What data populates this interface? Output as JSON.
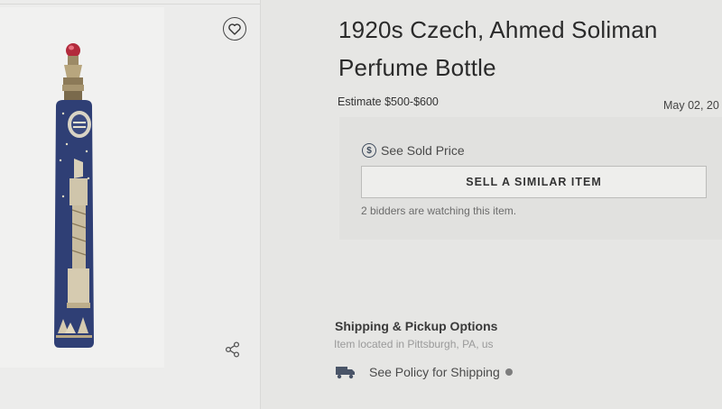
{
  "item": {
    "title": "1920s Czech, Ahmed Soliman Perfume Bottle",
    "estimate": "Estimate $500-$600",
    "date": "May 02, 20"
  },
  "bidding": {
    "see_sold_price": "See Sold Price",
    "sold_icon_glyph": "$",
    "sell_similar_button": "SELL A SIMILAR ITEM",
    "watchers_text": "2 bidders are watching this item."
  },
  "shipping": {
    "title": "Shipping & Pickup Options",
    "location": "Item located in Pittsburgh, PA, us",
    "policy_link": "See Policy for Shipping"
  },
  "icons": {
    "favorite": "heart-icon",
    "share": "share-icon",
    "sold_price": "dollar-circle-icon",
    "shipping": "truck-icon",
    "info": "info-dot-icon"
  },
  "colors": {
    "bottle_body": "#2f3f75",
    "bottle_cap": "#b22a3c",
    "gold": "#c9b47a",
    "icon_dark": "#3d4a5c"
  }
}
